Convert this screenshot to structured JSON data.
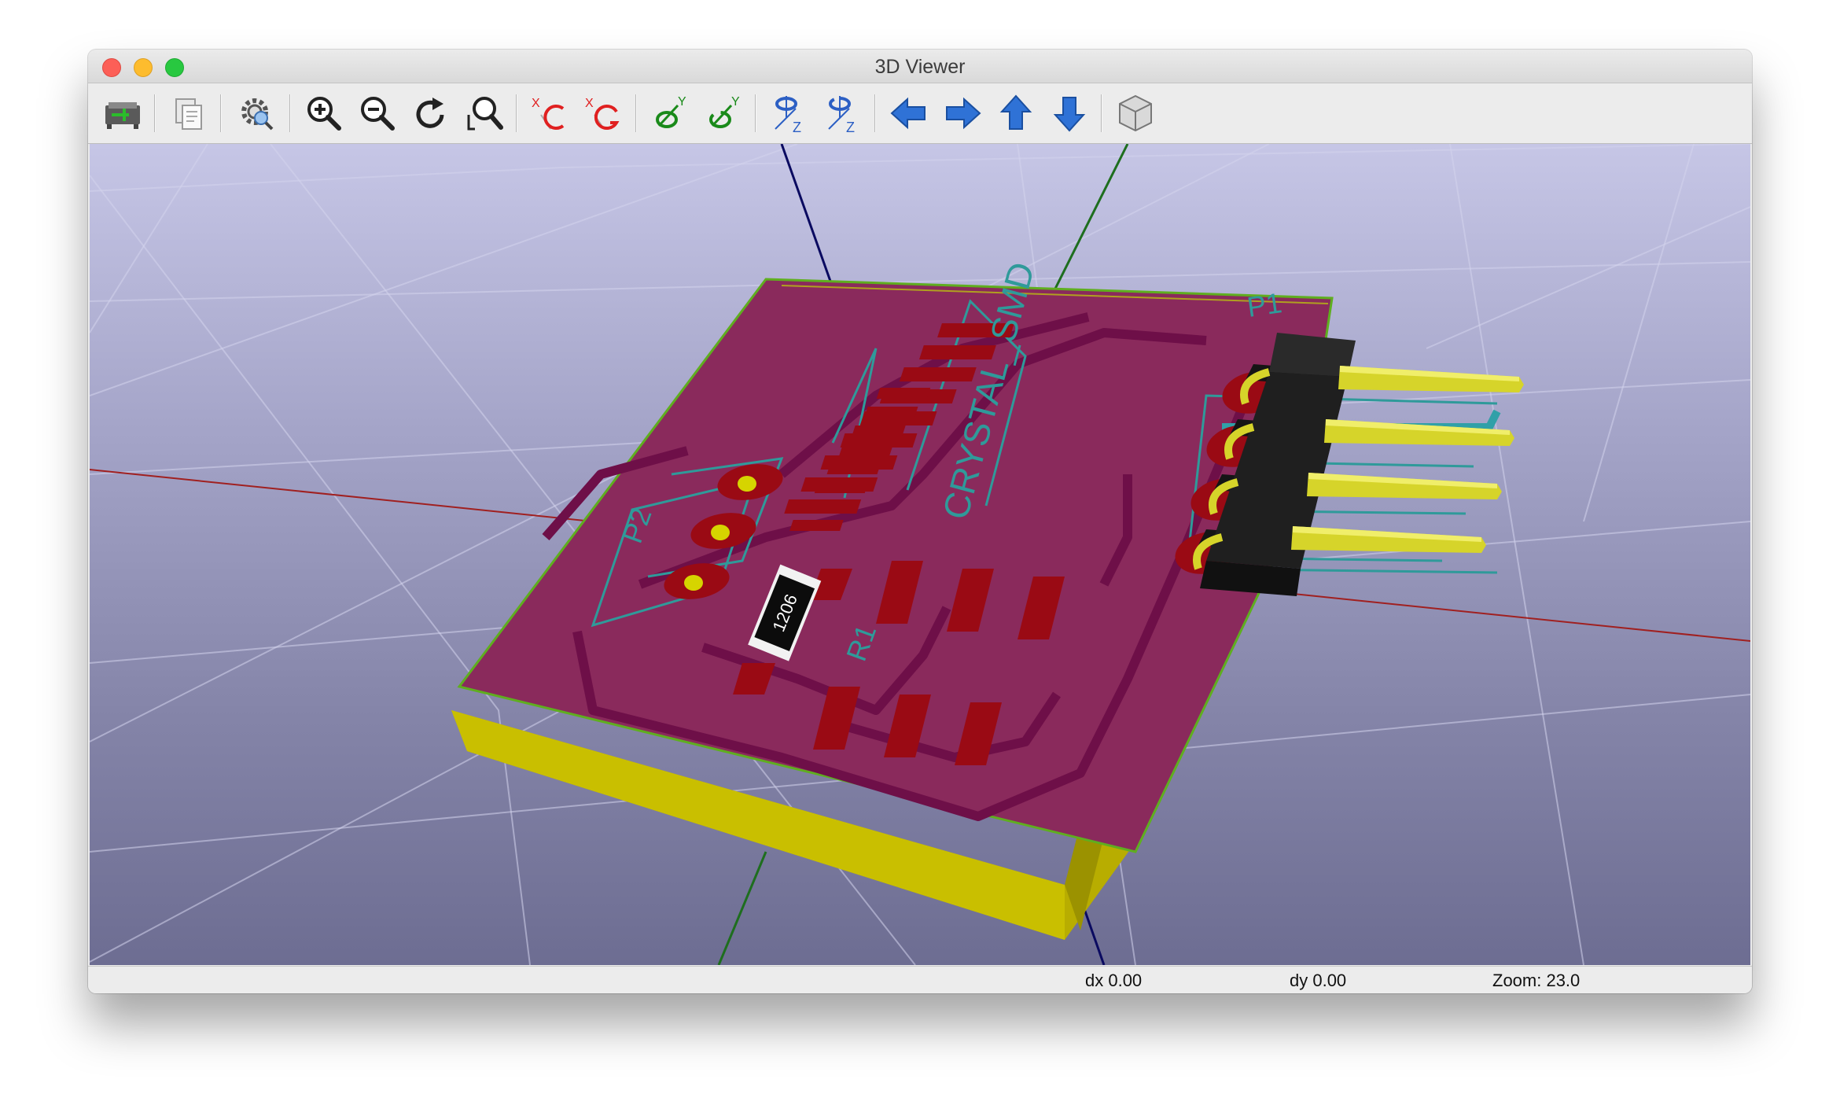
{
  "window": {
    "title": "3D Viewer"
  },
  "toolbar": {
    "buttons": [
      {
        "icon": "reload-board-icon",
        "tip": ""
      },
      {
        "icon": "copy-to-clipboard-icon",
        "tip": ""
      },
      {
        "icon": "settings-icon",
        "tip": ""
      },
      {
        "icon": "zoom-in-icon",
        "tip": ""
      },
      {
        "icon": "zoom-out-icon",
        "tip": ""
      },
      {
        "icon": "redraw-icon",
        "tip": ""
      },
      {
        "icon": "zoom-fit-icon",
        "tip": ""
      },
      {
        "icon": "rotate-x-cw-icon",
        "tip": ""
      },
      {
        "icon": "rotate-x-ccw-icon",
        "tip": ""
      },
      {
        "icon": "rotate-y-cw-icon",
        "tip": ""
      },
      {
        "icon": "rotate-y-ccw-icon",
        "tip": ""
      },
      {
        "icon": "rotate-z-cw-icon",
        "tip": ""
      },
      {
        "icon": "rotate-z-ccw-icon",
        "tip": ""
      },
      {
        "icon": "pan-left-icon",
        "tip": ""
      },
      {
        "icon": "pan-right-icon",
        "tip": ""
      },
      {
        "icon": "pan-up-icon",
        "tip": ""
      },
      {
        "icon": "pan-down-icon",
        "tip": ""
      },
      {
        "icon": "ortho-toggle-icon",
        "tip": ""
      }
    ],
    "axis_letters": {
      "x": "X",
      "y": "Y",
      "z": "Z"
    },
    "colors": {
      "rotate_x": "#e02020",
      "rotate_y": "#1a8a1a",
      "rotate_z": "#2c5fc4",
      "arrow": "#2f72d6"
    }
  },
  "scene": {
    "labels": {
      "crystal": "CRYSTAL_SMD",
      "header_ref": "P1",
      "connector_ref": "P2",
      "resistor_ref": "R1",
      "resistor_marking": "1206"
    },
    "colors": {
      "background_top": "#c6c6e6",
      "background_bottom": "#6d6d92",
      "board_top": "#8a2a5c",
      "copper": "#9a0a14",
      "silkscreen": "#2f9a9a",
      "board_edge": "#b8ad00",
      "axis_x": "#a02020",
      "axis_y": "#1e6e1e",
      "axis_z": "#0a0a60"
    }
  },
  "status": {
    "dx": "dx 0.00",
    "dy": "dy 0.00",
    "zoom": "Zoom: 23.0"
  }
}
